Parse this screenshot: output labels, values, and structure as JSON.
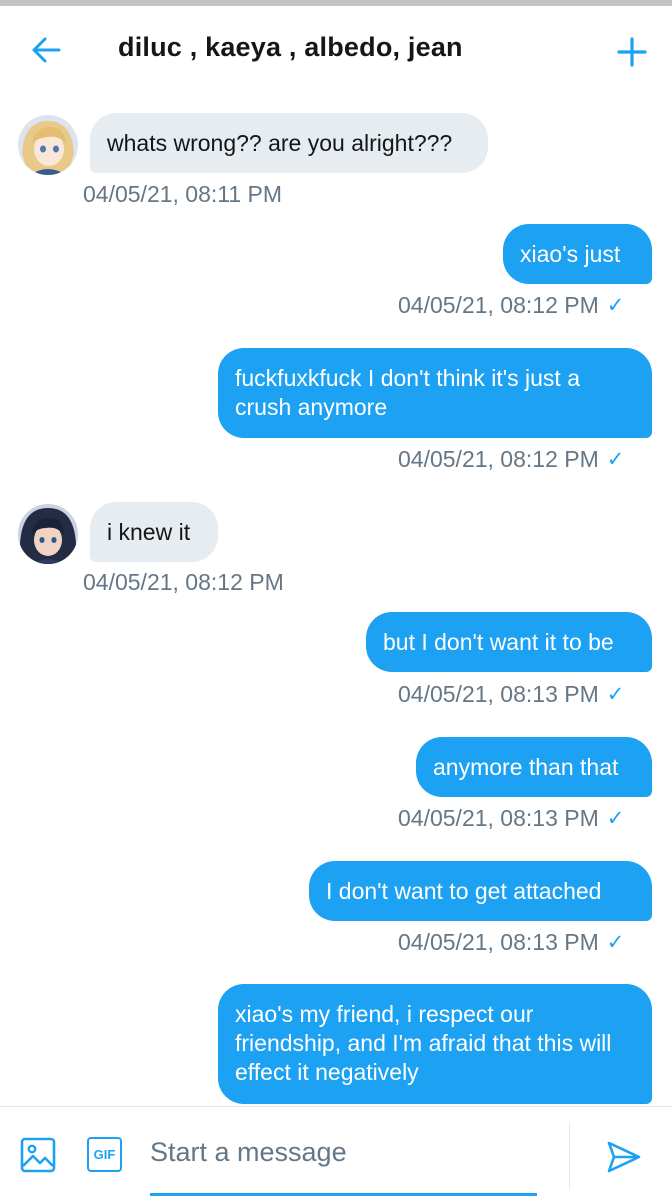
{
  "header": {
    "back_icon": "arrow-left-icon",
    "title": "diluc , kaeya , albedo, jean",
    "add_icon": "plus-icon"
  },
  "colors": {
    "accent": "#1da1f2",
    "incoming_bubble": "#e6ecf0",
    "timestamp": "#657786"
  },
  "messages": [
    {
      "direction": "in",
      "avatar": "avatar-blonde",
      "text": "whats wrong?? are you alright???",
      "timestamp": "04/05/21, 08:11 PM"
    },
    {
      "direction": "out",
      "text": "xiao's just",
      "timestamp": "04/05/21, 08:12 PM",
      "check": "✓"
    },
    {
      "direction": "out",
      "text": "fuckfuxkfuck I don't think it's just a crush anymore",
      "timestamp": "04/05/21, 08:12 PM",
      "check": "✓"
    },
    {
      "direction": "in",
      "avatar": "avatar-dark-hair",
      "text": "i knew it",
      "timestamp": "04/05/21, 08:12 PM"
    },
    {
      "direction": "out",
      "text": "but I don't want it to be",
      "timestamp": "04/05/21, 08:13 PM",
      "check": "✓"
    },
    {
      "direction": "out",
      "text": "anymore than that",
      "timestamp": "04/05/21, 08:13 PM",
      "check": "✓"
    },
    {
      "direction": "out",
      "text": "I don't want to get attached",
      "timestamp": "04/05/21, 08:13 PM",
      "check": "✓"
    },
    {
      "direction": "out",
      "text": "xiao's my friend, i respect our friendship, and I'm afraid that this will effect it negatively"
    }
  ],
  "composer": {
    "media_icon": "image-icon",
    "gif_label": "GIF",
    "placeholder": "Start a message",
    "send_icon": "send-icon"
  }
}
